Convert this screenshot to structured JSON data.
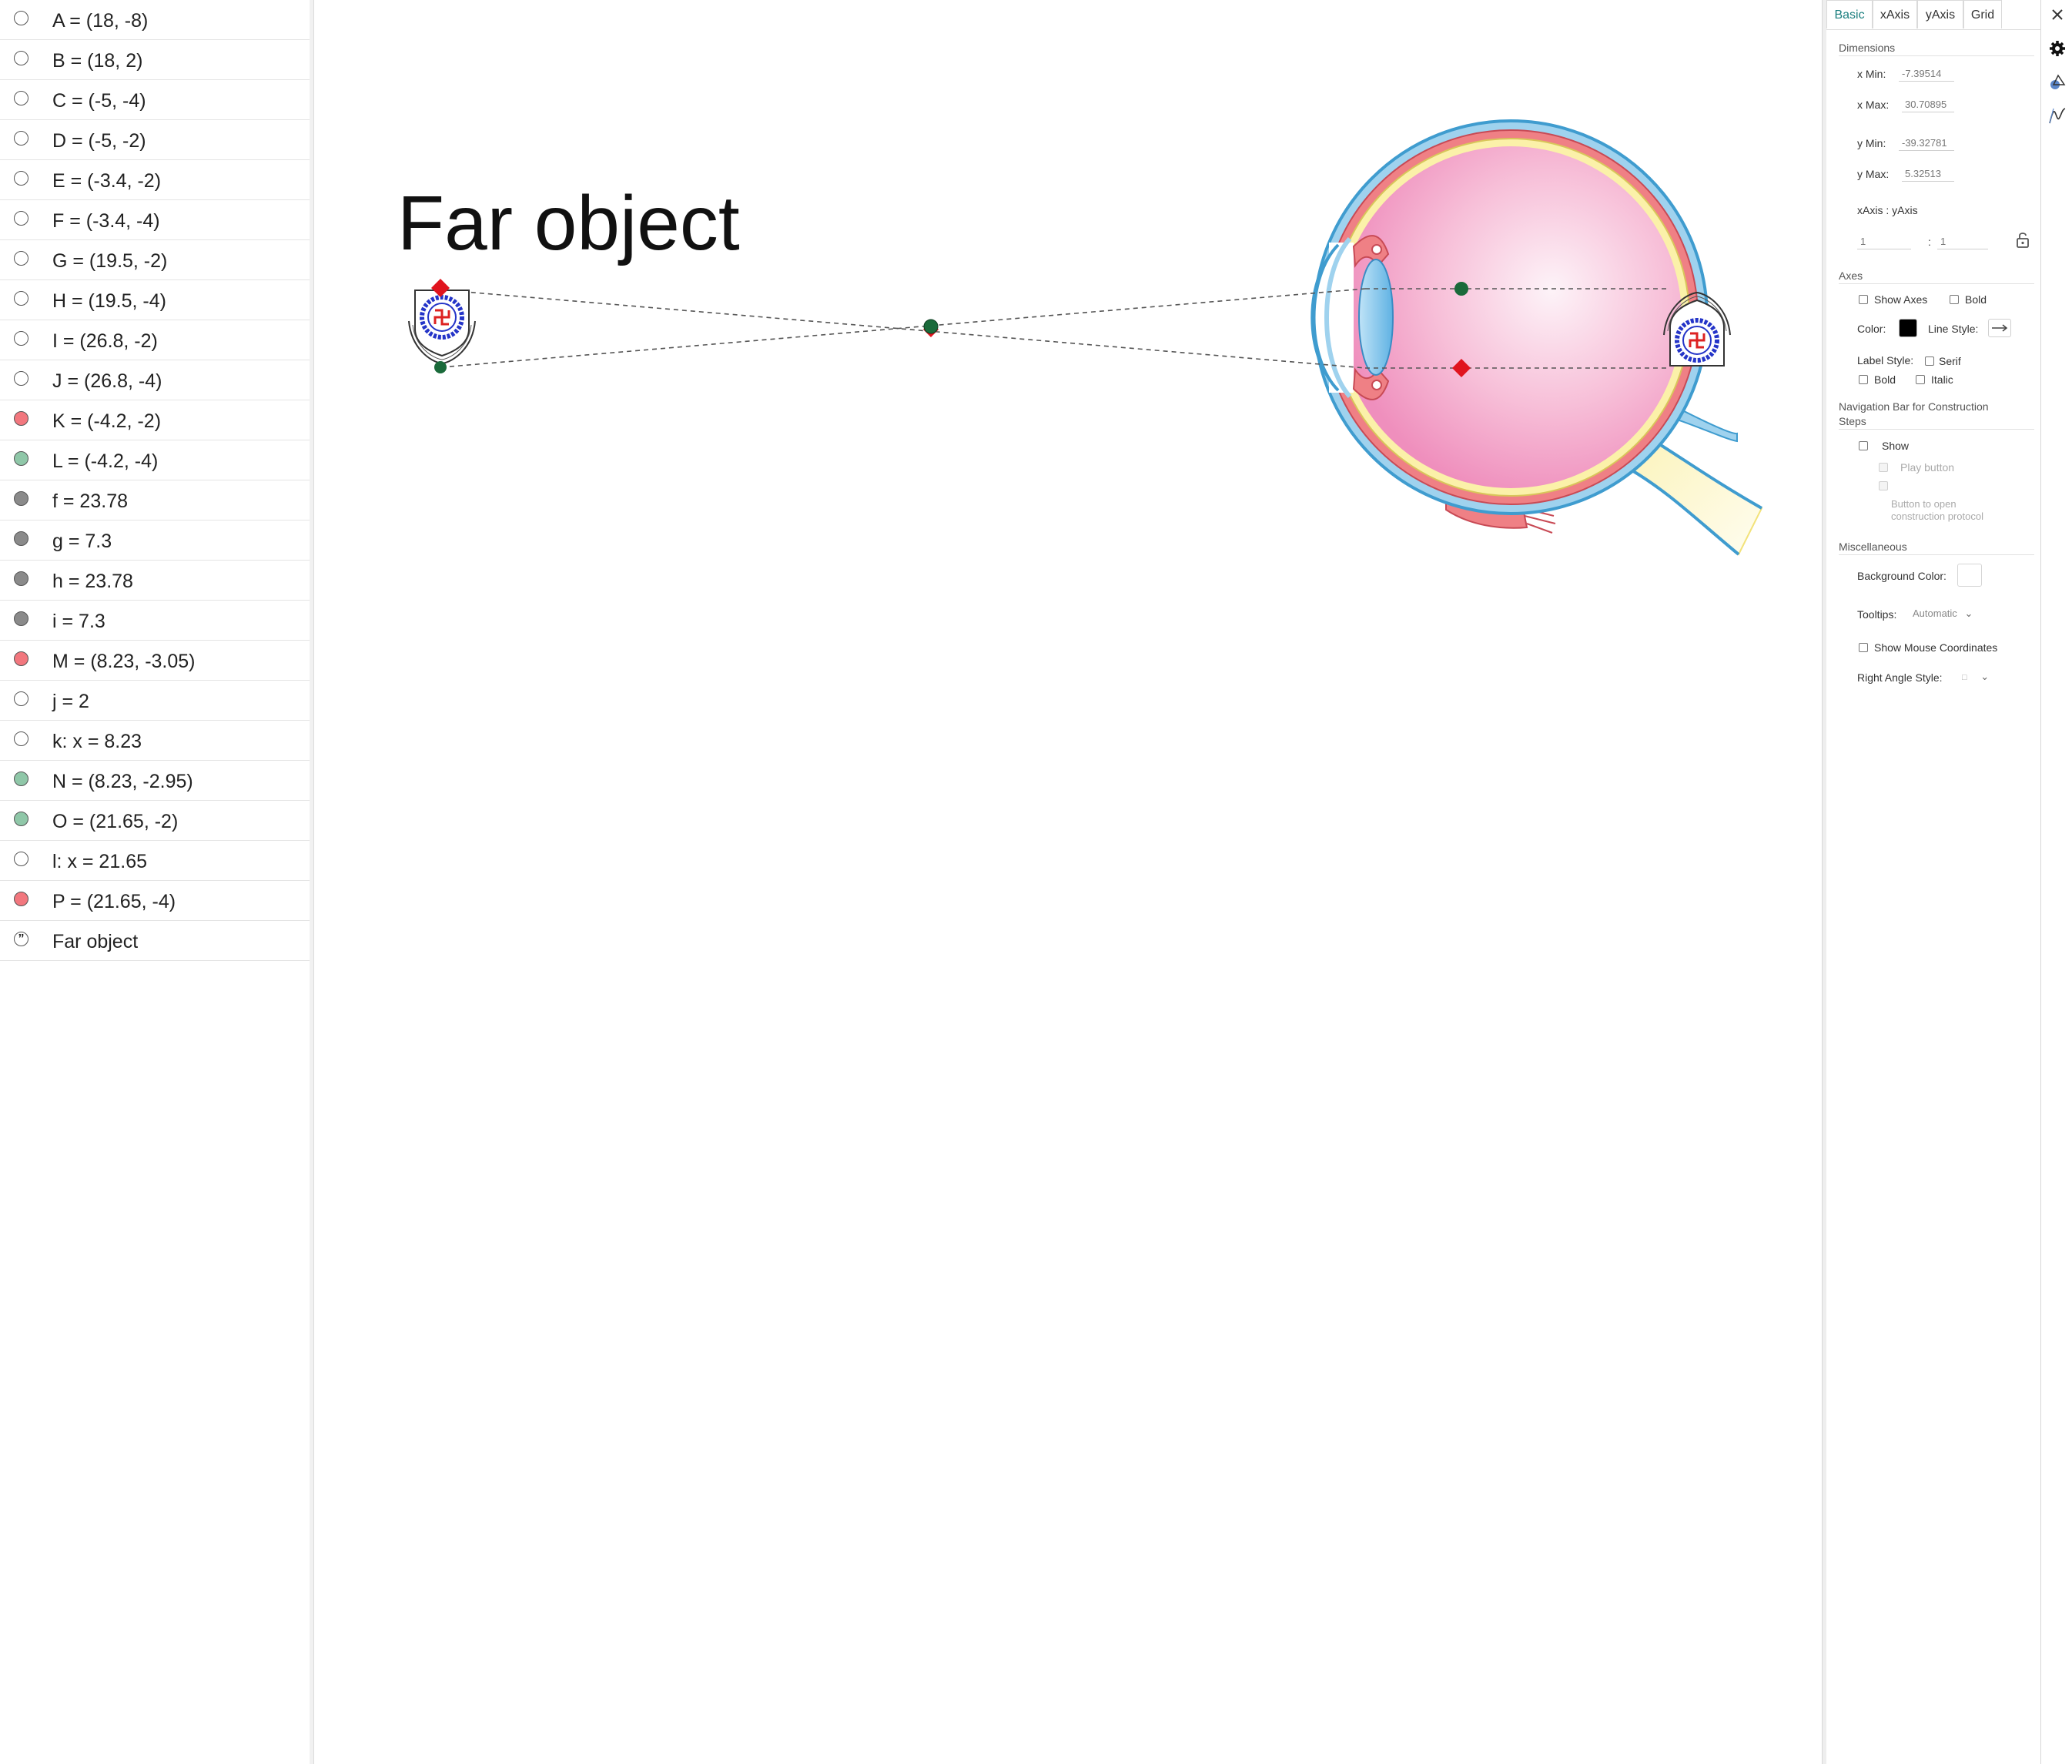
{
  "algebra": {
    "items": [
      {
        "text": "A = (18, -8)",
        "marble": "#ffffff"
      },
      {
        "text": "B = (18, 2)",
        "marble": "#ffffff"
      },
      {
        "text": "C = (-5, -4)",
        "marble": "#ffffff"
      },
      {
        "text": "D = (-5, -2)",
        "marble": "#ffffff"
      },
      {
        "text": "E = (-3.4, -2)",
        "marble": "#ffffff"
      },
      {
        "text": "F = (-3.4, -4)",
        "marble": "#ffffff"
      },
      {
        "text": "G = (19.5, -2)",
        "marble": "#ffffff"
      },
      {
        "text": "H = (19.5, -4)",
        "marble": "#ffffff"
      },
      {
        "text": "I = (26.8, -2)",
        "marble": "#ffffff"
      },
      {
        "text": "J = (26.8, -4)",
        "marble": "#ffffff"
      },
      {
        "text": "K = (-4.2, -2)",
        "marble": "#f2777e"
      },
      {
        "text": "L = (-4.2, -4)",
        "marble": "#8fc7a8"
      },
      {
        "text": "f = 23.78",
        "marble": "#8a8a8a"
      },
      {
        "text": "g = 7.3",
        "marble": "#8a8a8a"
      },
      {
        "text": "h = 23.78",
        "marble": "#8a8a8a"
      },
      {
        "text": "i = 7.3",
        "marble": "#8a8a8a"
      },
      {
        "text": "M = (8.23, -3.05)",
        "marble": "#f2777e"
      },
      {
        "text": "j = 2",
        "marble": "#ffffff"
      },
      {
        "text": "k: x = 8.23",
        "marble": "#ffffff"
      },
      {
        "text": "N = (8.23, -2.95)",
        "marble": "#8fc7a8"
      },
      {
        "text": "O = (21.65, -2)",
        "marble": "#8fc7a8"
      },
      {
        "text": "l: x = 21.65",
        "marble": "#ffffff"
      },
      {
        "text": "P = (21.65, -4)",
        "marble": "#f2777e"
      },
      {
        "text": "Far object",
        "marble": "quote-icon"
      }
    ]
  },
  "canvas": {
    "title": "Far object"
  },
  "settings": {
    "tabs": [
      "Basic",
      "xAxis",
      "yAxis",
      "Grid"
    ],
    "active_tab": "Basic",
    "dimensions": {
      "section": "Dimensions",
      "xmin_label": "x Min:",
      "xmin_value": "-7.39514",
      "xmax_label": "x Max:",
      "xmax_value": "30.70895",
      "ymin_label": "y Min:",
      "ymin_value": "-39.32781",
      "ymax_label": "y Max:",
      "ymax_value": "5.32513",
      "ratio_label": "xAxis : yAxis",
      "ratio_x": "1",
      "ratio_sep": ":",
      "ratio_y": "1"
    },
    "axes": {
      "section": "Axes",
      "show_axes": "Show Axes",
      "bold": "Bold",
      "color_label": "Color:",
      "color_value": "#000000",
      "line_style_label": "Line Style:",
      "label_style_label": "Label Style:",
      "serif": "Serif",
      "label_bold": "Bold",
      "italic": "Italic"
    },
    "navigation": {
      "section_line1": "Navigation Bar for Construction",
      "section_line2": "Steps",
      "show": "Show",
      "play_button": "Play button",
      "open_protocol_line1": "Button to open",
      "open_protocol_line2": "construction protocol"
    },
    "misc": {
      "section": "Miscellaneous",
      "bg_color_label": "Background Color:",
      "bg_color_value": "#ffffff",
      "tooltips_label": "Tooltips:",
      "tooltips_value": "Automatic",
      "mouse_coords": "Show Mouse Coordinates",
      "right_angle_label": "Right Angle Style:",
      "right_angle_value": "□"
    }
  },
  "iconbar": [
    "close-icon",
    "gear-icon",
    "graphics-style-icon",
    "function-icon"
  ]
}
